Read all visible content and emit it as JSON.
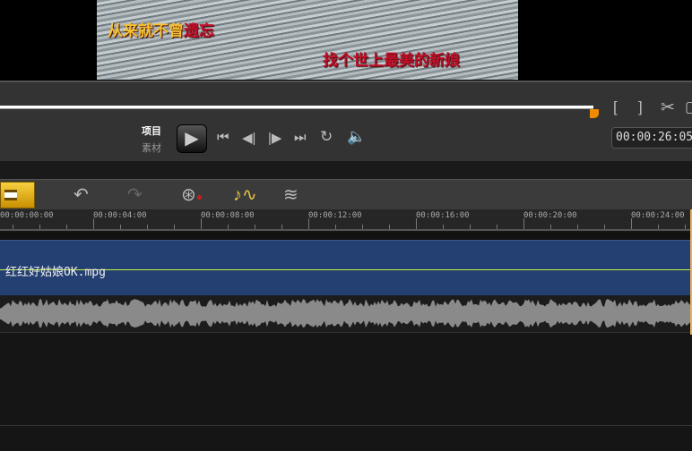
{
  "preview": {
    "lyric_line1_normal": "从来就不曾",
    "lyric_line1_highlight": "遗忘",
    "lyric_line2": "找个世上最美的新娘"
  },
  "controls": {
    "mode_project": "项目",
    "mode_clip": "素材",
    "timecode": "00:00:26:05",
    "mark_in": "[",
    "mark_out": "]",
    "scrub_progress": 1.0
  },
  "ruler": {
    "labels": [
      "00:00:00:00",
      "00:00:04:00",
      "00:00:08:00",
      "00:00:12:00",
      "00:00:16:00",
      "00:00:20:00",
      "00:00:24:00"
    ]
  },
  "track": {
    "clip_name": "红红好姑娘OK.mpg"
  }
}
